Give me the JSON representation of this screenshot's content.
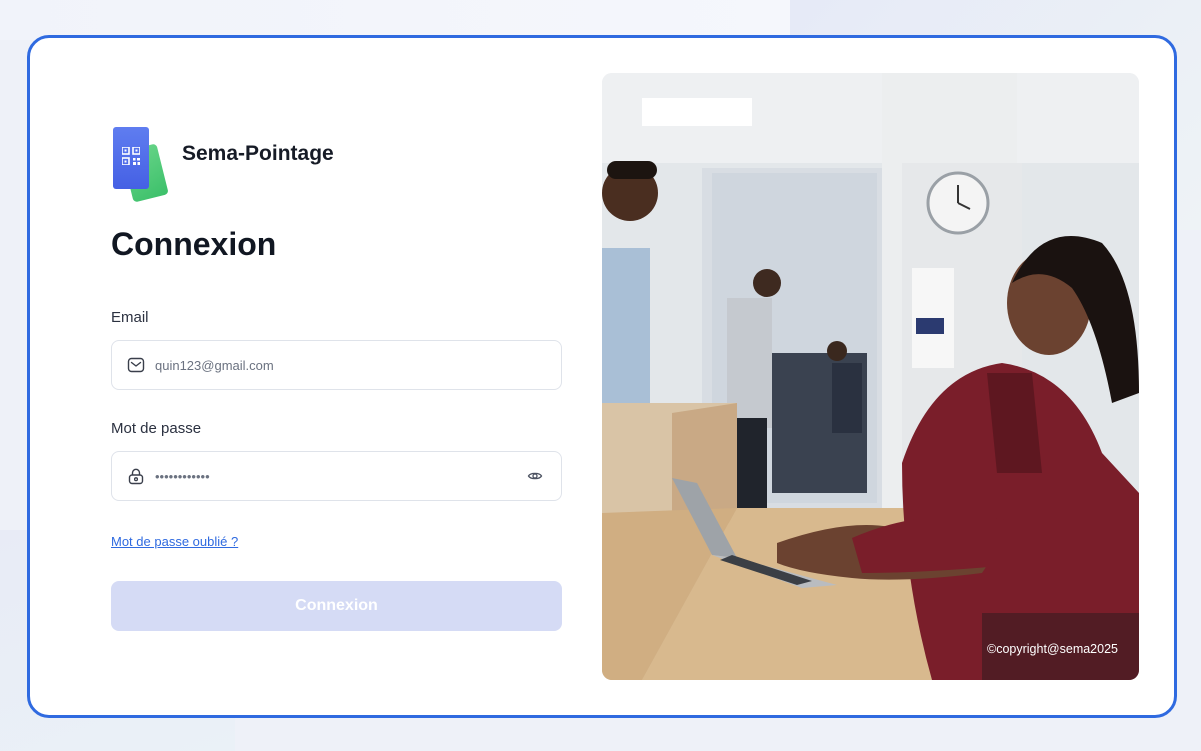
{
  "brand": {
    "name": "Sema-Pointage",
    "logo_icon": "qr-code-icon"
  },
  "form": {
    "title": "Connexion",
    "email_label": "Email",
    "email_value": "quin123@gmail.com",
    "email_icon": "mail-icon",
    "password_label": "Mot de passe",
    "password_value": "••••••••••••",
    "password_icon": "lock-icon",
    "toggle_visibility_icon": "eye-icon",
    "forgot_link": "Mot de passe oublié ?",
    "submit_label": "Connexion"
  },
  "photo": {
    "copyright": "©copyright@sema2025"
  },
  "colors": {
    "accent": "#2f6ae0",
    "button_disabled": "#d5dbf5",
    "logo_primary": "#4f6ae8",
    "logo_secondary": "#4cc877"
  }
}
